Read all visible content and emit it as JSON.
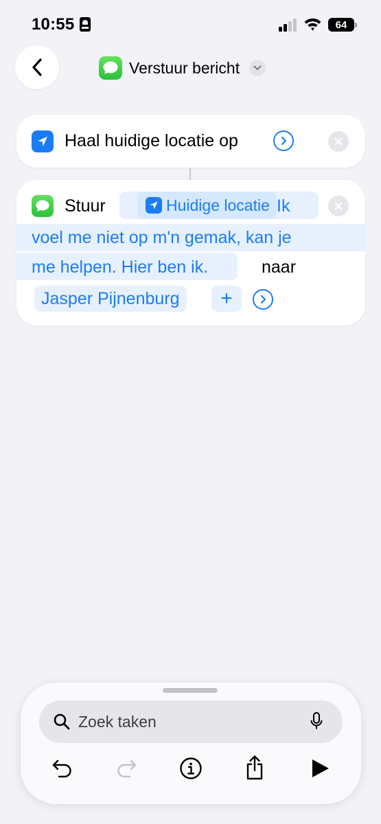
{
  "status_bar": {
    "time": "10:55",
    "battery": "64"
  },
  "header": {
    "title": "Verstuur bericht"
  },
  "actions": [
    {
      "label": "Haal huidige locatie op"
    },
    {
      "verb": "Stuur",
      "variable_token": "Huidige locatie",
      "message_lines": [
        "Ik",
        "voel me niet op m'n gemak, kan je",
        "me helpen. Hier ben ik."
      ],
      "connector_word": "naar",
      "recipient": "Jasper Pijnenburg",
      "add_symbol": "+"
    }
  ],
  "search": {
    "placeholder": "Zoek taken"
  },
  "colors": {
    "accent": "#1b7cf6",
    "messages_green": "#34c759",
    "background": "#f2f2f7",
    "token_background": "#e7f1fd"
  },
  "icons": [
    "back-chevron-icon",
    "messages-icon",
    "chevron-down-icon",
    "location-arrow-icon",
    "arrow-circle-icon",
    "remove-icon",
    "search-icon",
    "microphone-icon",
    "undo-icon",
    "redo-icon",
    "info-icon",
    "share-icon",
    "play-icon"
  ]
}
